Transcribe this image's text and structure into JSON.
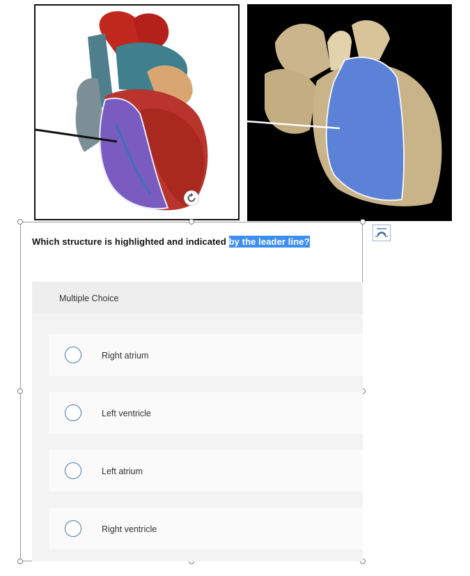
{
  "question": {
    "text_plain": "Which structure is highlighted and indicated ",
    "text_highlighted": "by the leader line?"
  },
  "multiple_choice": {
    "header": "Multiple Choice",
    "options": [
      {
        "label": "Right atrium"
      },
      {
        "label": "Left ventricle"
      },
      {
        "label": "Left atrium"
      },
      {
        "label": "Right ventricle"
      }
    ]
  },
  "images": {
    "model_heart": {
      "description_icon": "heart-model-image",
      "highlight_color": "#7a5bbf"
    },
    "specimen_heart": {
      "description_icon": "heart-specimen-image",
      "highlight_color": "#5b82d6"
    }
  },
  "colors": {
    "selection_highlight": "#3c8ef0",
    "radio_border": "#4a76a8",
    "header_bg": "#eeeeee"
  }
}
